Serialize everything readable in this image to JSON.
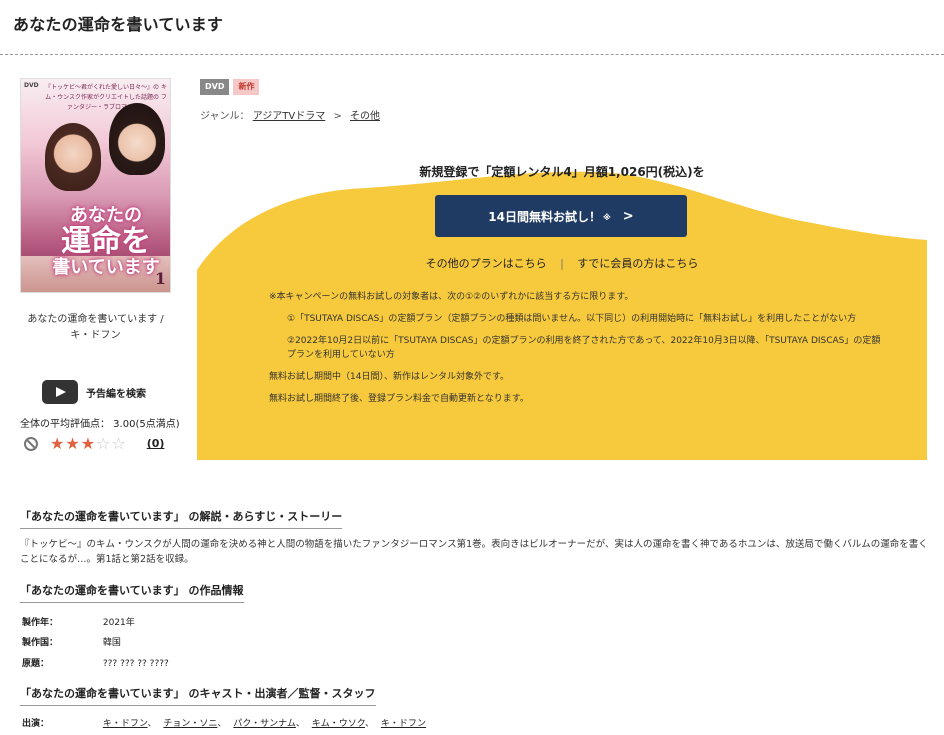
{
  "page": {
    "title": "あなたの運命を書いています"
  },
  "cover": {
    "dvd_tag": "DVD",
    "tagline": "『トッケビ～君がくれた愛しい日々～』の キム・ウンスク作家がクリエイトした話題の ファンタジー・ラブロマンス！",
    "logo_line1": "あなたの",
    "logo_line2": "運命を",
    "logo_line3": "書いています",
    "vol": "1"
  },
  "caption": {
    "line1": "あなたの運命を書いています /",
    "line2": "キ・ドフン"
  },
  "trailer": {
    "label": "予告編を検索"
  },
  "rating": {
    "text": "全体の平均評価点： 3.00(5点満点)",
    "score": 3,
    "max": 5,
    "count": "(0)",
    "star_on_color": "#e0623f",
    "star_off_color": "#c8c8c8"
  },
  "badges": {
    "dvd": "DVD",
    "new": "新作"
  },
  "genre": {
    "label": "ジャンル：",
    "cat1": "アジアTVドラマ",
    "sep": ">",
    "cat2": "その他"
  },
  "promo": {
    "headline": "新規登録で「定額レンタル4」月額1,026円(税込)を",
    "button_label": "14日間無料お試し！",
    "button_mark": "※",
    "button_chevron": ">",
    "other_plans": "その他のプランはこちら",
    "divider": "|",
    "member_link": "すでに会員の方はこちら",
    "note_intro": "※本キャンペーンの無料お試しの対象者は、次の①②のいずれかに該当する方に限ります。",
    "note1": "①「TSUTAYA DISCAS」の定額プラン（定額プランの種類は問いません。以下同じ）の利用開始時に「無料お試し」を利用したことがない方",
    "note2": "②2022年10月2日以前に「TSUTAYA DISCAS」の定額プランの利用を終了された方であって、2022年10月3日以降、「TSUTAYA DISCAS」の定額プランを利用していない方",
    "note3": "無料お試し期間中（14日間）、新作はレンタル対象外です。",
    "note4": "無料お試し期間終了後、登録プラン料金で自動更新となります。",
    "bg_color": "#f7c93c",
    "button_color": "#1f3b63"
  },
  "synopsis": {
    "heading": "「あなたの運命を書いています」 の解説・あらすじ・ストーリー",
    "text": "『トッケビ～』のキム・ウンスクが人間の運命を決める神と人間の物語を描いたファンタジーロマンス第1巻。表向きはビルオーナーだが、実は人の運命を書く神であるホユンは、放送局で働くバルムの運命を書くことになるが…。第1話と第2話を収録。"
  },
  "info": {
    "heading": "「あなたの運命を書いています」 の作品情報",
    "year_label": "製作年：",
    "year_value": "2021年",
    "country_label": "製作国：",
    "country_value": "韓国",
    "original_label": "原題：",
    "original_value": "??? ??? ?? ????"
  },
  "cast": {
    "heading": "「あなたの運命を書いています」 のキャスト・出演者／監督・スタッフ",
    "label": "出演：",
    "members": [
      "キ・ドフン",
      "チョン・ソニ",
      "パク・サンナム",
      "キム・ウソク",
      "キ・ドフン"
    ]
  }
}
